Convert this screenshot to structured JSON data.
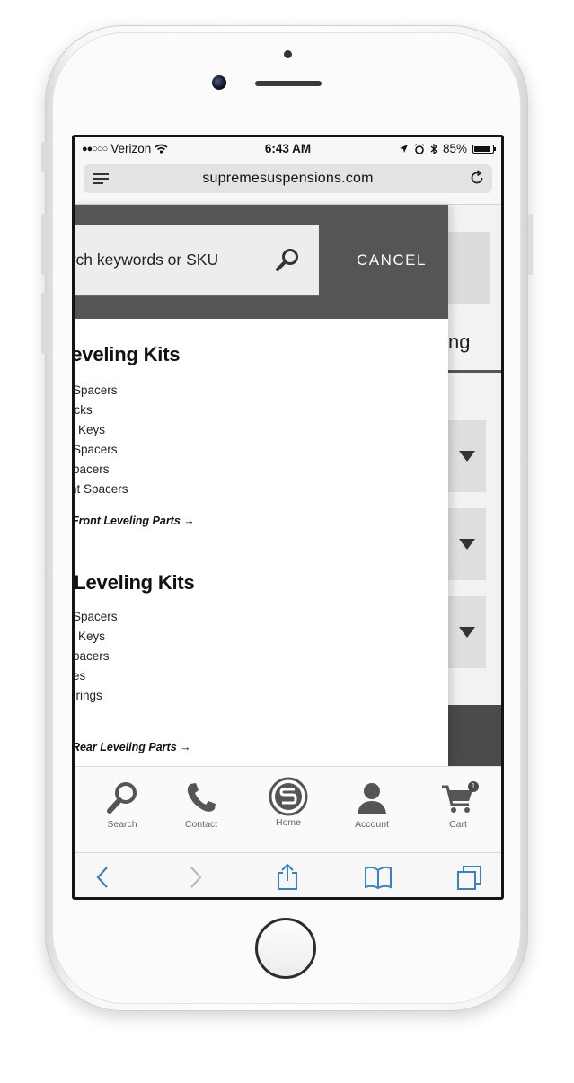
{
  "status_bar": {
    "signal": "●●○○○",
    "carrier": "Verizon",
    "time": "6:43 AM",
    "battery": "85%"
  },
  "browser": {
    "url": "supremesuspensions.com"
  },
  "search": {
    "placeholder": "Search keywords or SKU",
    "visible_text": "arch keywords or SKU",
    "cancel_label": "CANCEL"
  },
  "background_page": {
    "heading_fragment": "ng"
  },
  "menu": {
    "front": {
      "title": "t Leveling Kits",
      "items": [
        "Spacers",
        "acks",
        "Keys",
        "Spacers",
        "pacers",
        "int Spacers"
      ],
      "view_all": "l Front Leveling Parts →"
    },
    "rear": {
      "title": "r Leveling Kits",
      "items": [
        "Spacers",
        "Keys",
        "pacers",
        "es",
        "prings"
      ],
      "view_all": "l Rear Leveling Parts →"
    }
  },
  "tabbar": {
    "search": "Search",
    "contact": "Contact",
    "home": "Home",
    "account": "Account",
    "cart": "Cart",
    "cart_count": "1"
  },
  "colors": {
    "panel_header": "#555555",
    "ios_blue": "#3a82c8",
    "tab_icon": "#555555"
  }
}
